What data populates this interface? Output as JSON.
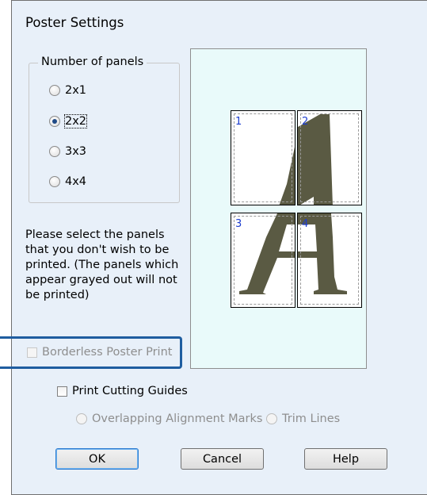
{
  "dialog": {
    "title": "Poster Settings"
  },
  "panels_group": {
    "legend": "Number of panels",
    "options": [
      {
        "label": "2x1",
        "checked": false
      },
      {
        "label": "2x2",
        "checked": true
      },
      {
        "label": "3x3",
        "checked": false
      },
      {
        "label": "4x4",
        "checked": false
      }
    ]
  },
  "description": "Please select the panels that you don't wish to be printed. (The panels which appear grayed out will not be printed)",
  "preview": {
    "panels": [
      "1",
      "2",
      "3",
      "4"
    ],
    "background_color": "#e9fafa",
    "glyph_color": "#5a5a43"
  },
  "borderless": {
    "label": "Borderless Poster Print",
    "checked": false,
    "enabled": false
  },
  "cutting_guides": {
    "label": "Print Cutting Guides",
    "checked": false,
    "options": [
      {
        "label": "Overlapping Alignment Marks",
        "enabled": false
      },
      {
        "label": "Trim Lines",
        "enabled": false
      }
    ]
  },
  "buttons": {
    "ok": "OK",
    "cancel": "Cancel",
    "help": "Help"
  },
  "colors": {
    "dialog_bg": "#e8f0f9",
    "highlight_border": "#1f5da0",
    "panel_number": "#1b3ccf"
  }
}
